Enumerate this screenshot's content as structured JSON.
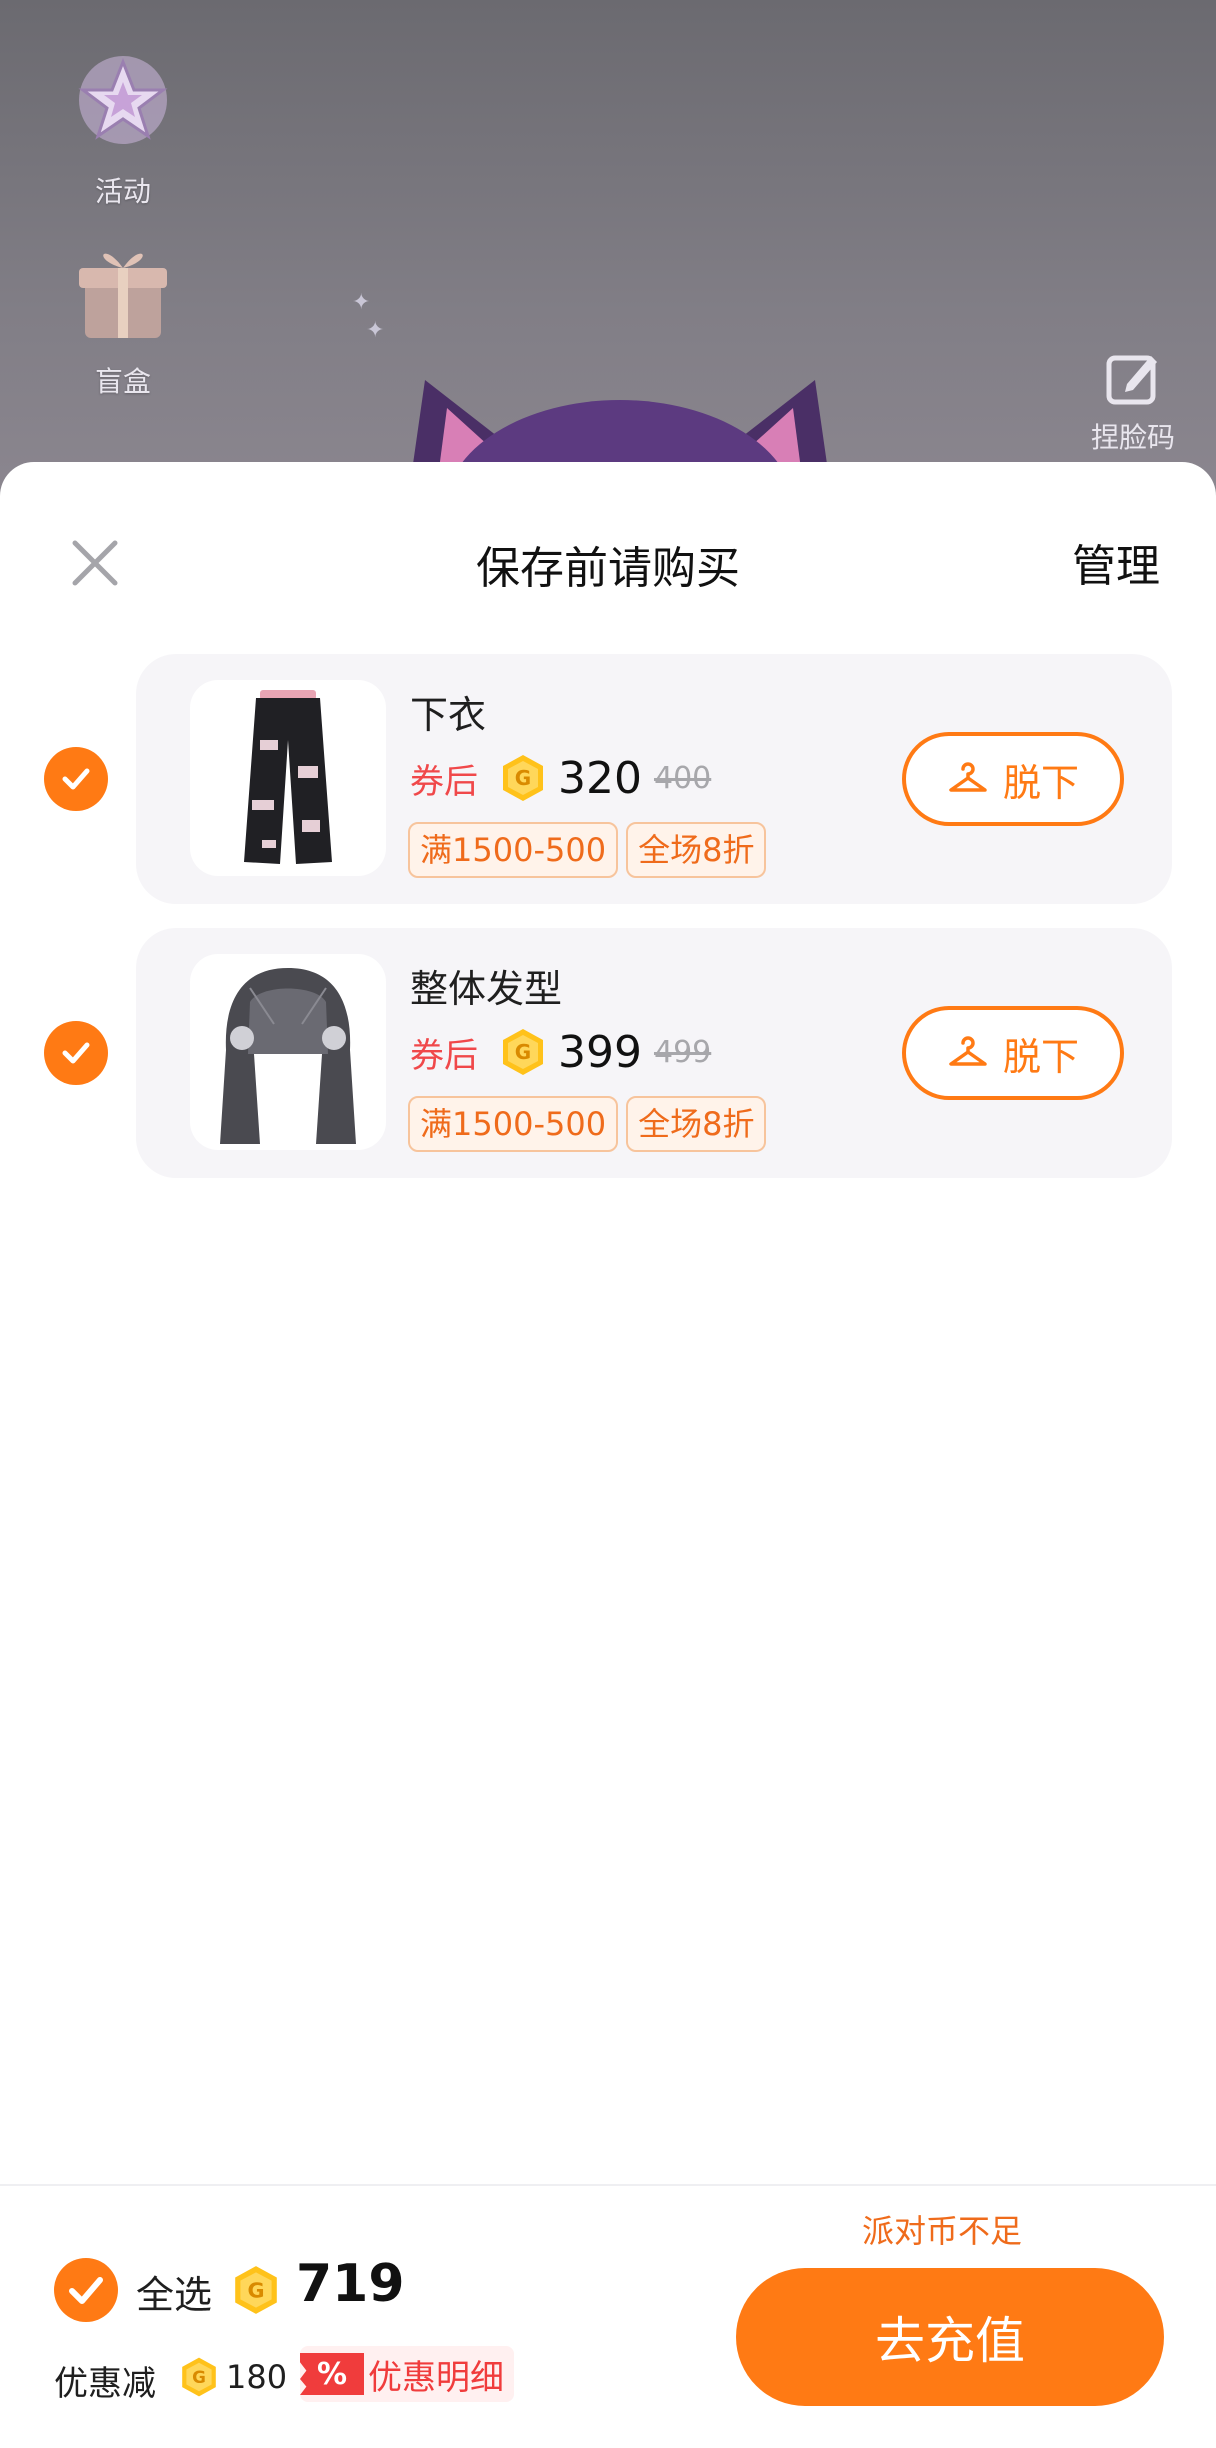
{
  "background": {
    "side_menu": [
      {
        "label": "活动",
        "icon": "star-badge-icon"
      },
      {
        "label": "盲盒",
        "icon": "gift-box-icon"
      }
    ],
    "face_code": {
      "label": "捏脸码",
      "icon": "edit-square-icon"
    }
  },
  "sheet": {
    "title": "保存前请购买",
    "manage_label": "管理",
    "items": [
      {
        "name": "下衣",
        "checked": true,
        "after_coupon_label": "券后",
        "price": "320",
        "original_price": "400",
        "tags": [
          "满1500-500",
          "全场8折"
        ],
        "action_label": "脱下",
        "thumbnail": "ripped-pants-image"
      },
      {
        "name": "整体发型",
        "checked": true,
        "after_coupon_label": "券后",
        "price": "399",
        "original_price": "499",
        "tags": [
          "满1500-500",
          "全场8折"
        ],
        "action_label": "脱下",
        "thumbnail": "hairstyle-image"
      }
    ]
  },
  "footer": {
    "select_all_label": "全选",
    "total": "719",
    "discount_label": "优惠减",
    "discount_amount": "180",
    "discount_badge": "%",
    "discount_detail_label": "优惠明细",
    "insufficient_text": "派对币不足",
    "recharge_label": "去充值"
  },
  "colors": {
    "accent": "#ff7a14",
    "price_red": "#f0484a",
    "tag_text": "#ef6b1b",
    "card_bg": "#f6f5f8"
  }
}
